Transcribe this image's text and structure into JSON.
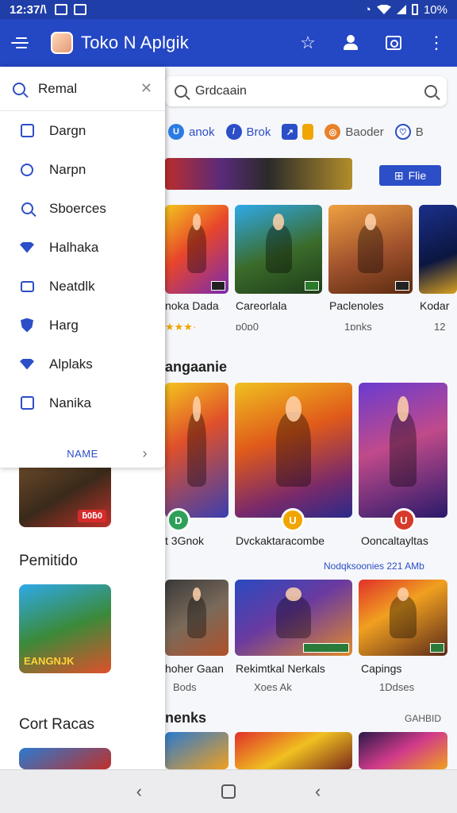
{
  "status": {
    "time": "12:37/\\",
    "battery": "10%"
  },
  "app": {
    "title": "Toko N Aplgik"
  },
  "drawer_menu": {
    "search_label": "Remal",
    "items": [
      {
        "label": "Dargn",
        "icon": "square-icon"
      },
      {
        "label": "Narpn",
        "icon": "shield-icon"
      },
      {
        "label": "Sboerces",
        "icon": "search-icon"
      },
      {
        "label": "Halhaka",
        "icon": "gem-icon"
      },
      {
        "label": "Neatdlk",
        "icon": "card-icon"
      },
      {
        "label": "Harg",
        "icon": "shield-icon"
      },
      {
        "label": "Alplaks",
        "icon": "gem-icon"
      },
      {
        "label": "Nanika",
        "icon": "square-icon"
      }
    ],
    "footer": "NAME"
  },
  "drawer_content": {
    "badge": "ƃ0ƃ0",
    "section1": "Pemitido",
    "section2": "Cort Racas",
    "tile_caption": "EANGNJK"
  },
  "search": {
    "value": "Grdcaain"
  },
  "chips": [
    {
      "label": "anok",
      "color": "#2c7be5",
      "glyph": "U"
    },
    {
      "label": "Brok",
      "color": "#2c4ec7",
      "glyph": "/"
    },
    {
      "label": "",
      "color": "#2c4ec7",
      "glyph": "↗"
    },
    {
      "label": "Baoder",
      "color": "#e8812a",
      "glyph": "◎"
    },
    {
      "label": "B",
      "color": "#2c4ec7",
      "glyph": "♡"
    }
  ],
  "filter": {
    "label": "Flie"
  },
  "row1": [
    {
      "title": "noka Dada",
      "sub": "★★★·",
      "badge": ""
    },
    {
      "title": "Careorlala",
      "sub": "ɒ0ɒ0",
      "badge": ""
    },
    {
      "title": "Paclenoles",
      "sub": "1ɒnks",
      "badge": ""
    },
    {
      "title": "Kodar",
      "sub": "12",
      "badge": ""
    }
  ],
  "section_mid": "angaanie",
  "row2": [
    {
      "title": "t 3Gnok",
      "sub": ""
    },
    {
      "title": "Dvckaktaracombe",
      "sub": ""
    },
    {
      "title": "Ooncaltayltas",
      "sub": ""
    }
  ],
  "row2_link": "Nodqksoonies 221 AMb",
  "row3": [
    {
      "title": "hoher Gaan",
      "sub": "Bods"
    },
    {
      "title": "Rekimtkal Nerkals",
      "sub": "Xoes   Ak"
    },
    {
      "title": "Capings",
      "sub": "1Ddses"
    }
  ],
  "section_bottom": "nenks",
  "bottom_link": "GAHBID",
  "nav": {
    "back": "‹",
    "recent": "‹"
  }
}
